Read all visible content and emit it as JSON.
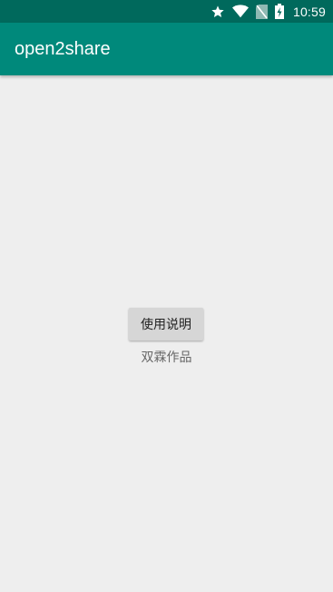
{
  "status_bar": {
    "time": "10:59",
    "icons": [
      "star-icon",
      "wifi-icon",
      "no-sim-icon",
      "battery-charging-icon"
    ],
    "color": "#00695c"
  },
  "app_bar": {
    "title": "open2share",
    "color": "#00897b"
  },
  "main": {
    "guide_button_label": "使用说明",
    "credit_text": "双霖作品",
    "background": "#eeeeee"
  }
}
